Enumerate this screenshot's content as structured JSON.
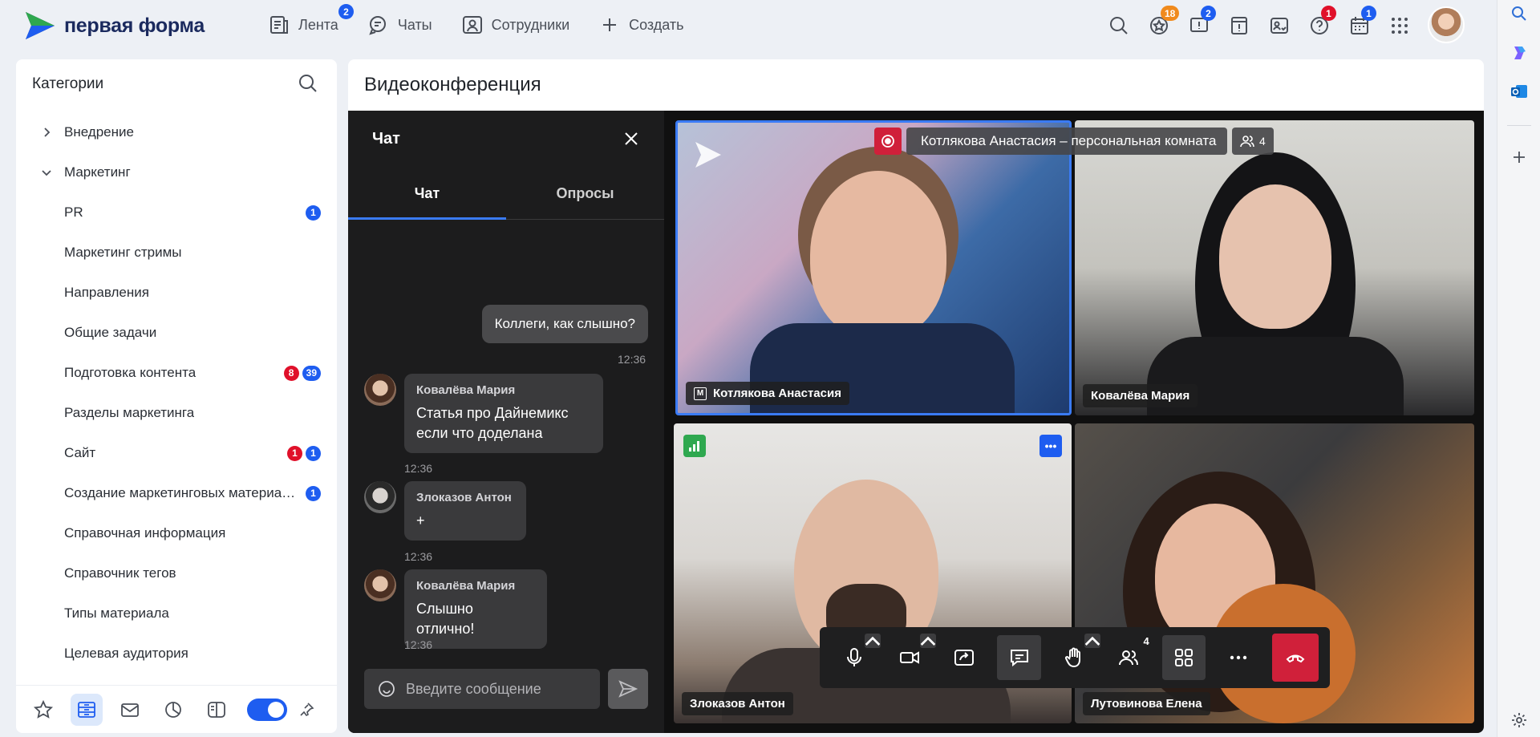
{
  "app": {
    "logo_text": "первая форма"
  },
  "nav": [
    {
      "label": "Лента",
      "badge": "2"
    },
    {
      "label": "Чаты",
      "badge": ""
    },
    {
      "label": "Сотрудники",
      "badge": ""
    },
    {
      "label": "Создать",
      "badge": ""
    }
  ],
  "right_badges": {
    "favorites": "18",
    "messages": "2",
    "help": "1",
    "calendar": "1"
  },
  "sidebar": {
    "title": "Категории",
    "items": [
      {
        "label": "Внедрение",
        "level": "root",
        "expanded": false
      },
      {
        "label": "Маркетинг",
        "level": "root",
        "expanded": true
      },
      {
        "label": "PR",
        "blue": "1",
        "red": ""
      },
      {
        "label": "Маркетинг стримы",
        "blue": "",
        "red": ""
      },
      {
        "label": "Направления",
        "blue": "",
        "red": ""
      },
      {
        "label": "Общие задачи",
        "blue": "",
        "red": ""
      },
      {
        "label": "Подготовка контента",
        "blue": "39",
        "red": "8"
      },
      {
        "label": "Разделы маркетинга",
        "blue": "",
        "red": ""
      },
      {
        "label": "Сайт",
        "blue": "1",
        "red": "1"
      },
      {
        "label": "Создание маркетинговых материалов",
        "blue": "1",
        "red": ""
      },
      {
        "label": "Справочная информация",
        "blue": "",
        "red": ""
      },
      {
        "label": "Справочник тегов",
        "blue": "",
        "red": ""
      },
      {
        "label": "Типы материала",
        "blue": "",
        "red": ""
      },
      {
        "label": "Целевая аудитория",
        "blue": "",
        "red": ""
      }
    ]
  },
  "main": {
    "title": "Видеоконференция"
  },
  "chat": {
    "title": "Чат",
    "tabs": [
      "Чат",
      "Опросы"
    ],
    "outgoing": {
      "text": "Коллеги, как слышно?",
      "time": "12:36"
    },
    "messages": [
      {
        "author": "Ковалёва Мария",
        "text": "Статья про Дайнемикс если что доделана",
        "time": "12:36"
      },
      {
        "author": "Злоказов Антон",
        "text": "+",
        "time": "12:36"
      },
      {
        "author": "Ковалёва Мария",
        "text": "Слышно отлично!",
        "time": "12:36"
      }
    ],
    "input_placeholder": "Введите сообщение"
  },
  "video": {
    "recording_title": "Котлякова Анастасия – персональная комната",
    "participants_count": "4",
    "tiles": [
      {
        "name": "Котлякова Анастасия",
        "moderator_mark": "M"
      },
      {
        "name": "Ковалёва Мария"
      },
      {
        "name": "Злоказов Антон"
      },
      {
        "name": "Лутовинова Елена"
      }
    ],
    "more_label": "•••",
    "controls_participants": "4"
  },
  "colors": {
    "accent": "#1e5df0",
    "danger": "#d0203a",
    "brand": "#1b2a5e"
  }
}
